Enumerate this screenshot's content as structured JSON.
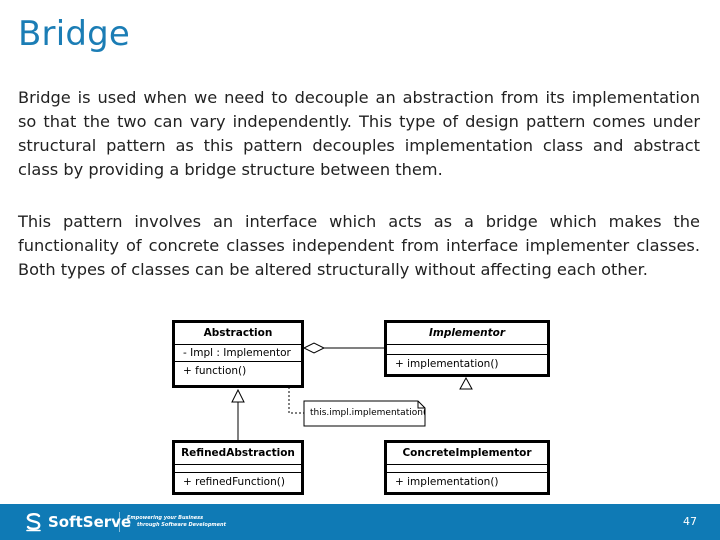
{
  "slide": {
    "title": "Bridge",
    "paragraphs": [
      "Bridge is used when we need to decouple an abstraction from its implementation so that the two can vary independently. This type of design pattern comes under structural pattern as this pattern decouples implementation class and abstract class by providing a bridge structure between them.",
      "This pattern involves an interface which acts as a bridge which makes the functionality of concrete classes independent from interface implementer classes. Both types of classes can be altered structurally without affecting each other."
    ]
  },
  "diagram": {
    "classes": {
      "abstraction": {
        "name": "Abstraction",
        "attribute": "-  Impl : Implementor",
        "operation": "+ function()"
      },
      "implementor": {
        "name": "Implementor",
        "attribute": "",
        "operation": "+  implementation()"
      },
      "refined": {
        "name": "RefinedAbstraction",
        "attribute": "",
        "operation": "+ refinedFunction()"
      },
      "concrete": {
        "name": "ConcreteImplementor",
        "attribute": "",
        "operation": "+ implementation()"
      }
    },
    "note": "this.impl.implementation();"
  },
  "footer": {
    "brand": "SoftServe",
    "tagline_line1": "Empowering your Business",
    "tagline_line2": "through Software Development",
    "page_number": "47",
    "color": "#0f7ab5"
  }
}
